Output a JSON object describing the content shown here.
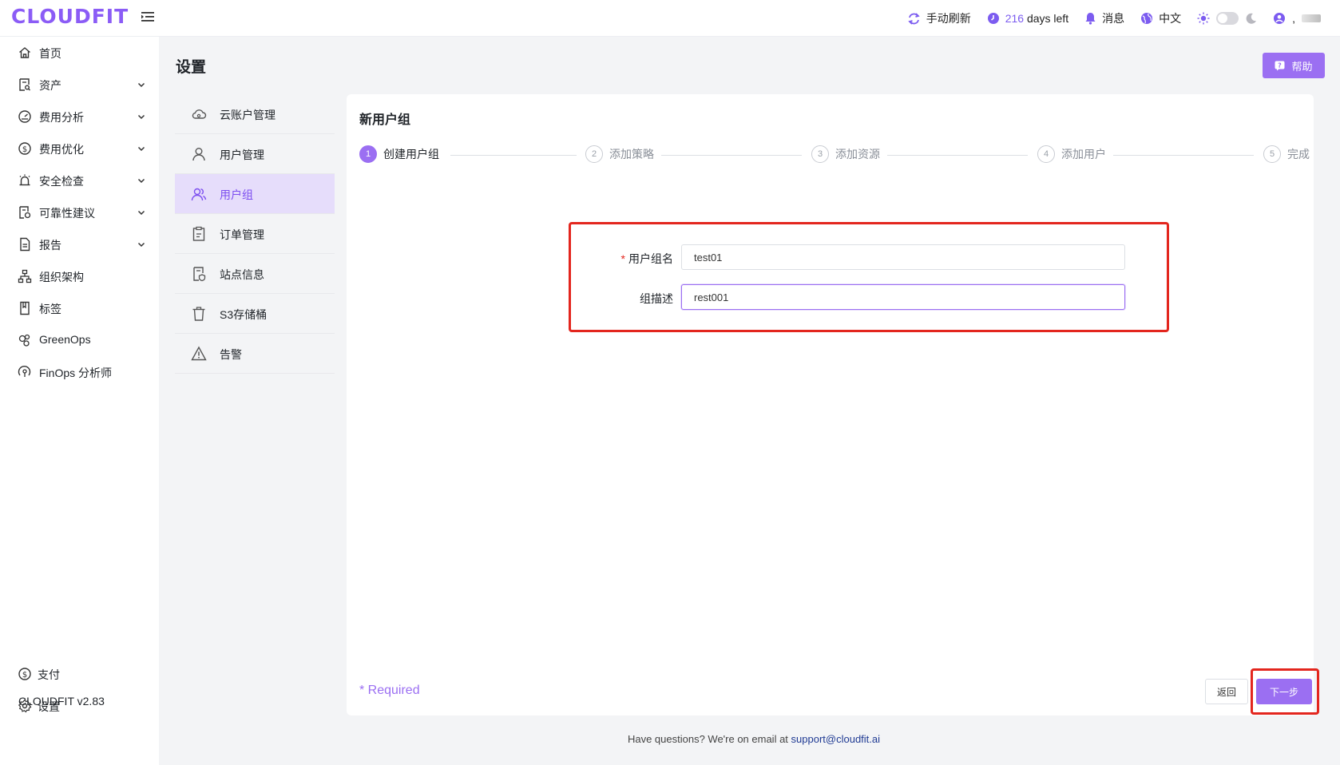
{
  "app": {
    "logo": "CLOUDFIT"
  },
  "topbar": {
    "refresh_label": "手动刷新",
    "days_value": "216",
    "days_suffix": "days left",
    "messages_label": "消息",
    "language_label": "中文",
    "user_suffix": ","
  },
  "sidebar": {
    "items": [
      {
        "label": "首页",
        "icon": "home-icon",
        "has_children": false
      },
      {
        "label": "资产",
        "icon": "asset-icon",
        "has_children": true
      },
      {
        "label": "费用分析",
        "icon": "cost-analysis-icon",
        "has_children": true
      },
      {
        "label": "费用优化",
        "icon": "dollar-icon",
        "has_children": true
      },
      {
        "label": "安全检查",
        "icon": "alarm-icon",
        "has_children": true
      },
      {
        "label": "可靠性建议",
        "icon": "reliability-icon",
        "has_children": true
      },
      {
        "label": "报告",
        "icon": "report-icon",
        "has_children": true
      },
      {
        "label": "组织架构",
        "icon": "org-icon",
        "has_children": false
      },
      {
        "label": "标签",
        "icon": "tag-icon",
        "has_children": false
      },
      {
        "label": "GreenOps",
        "icon": "greenops-icon",
        "has_children": false
      },
      {
        "label": "FinOps 分析师",
        "icon": "analyst-icon",
        "has_children": false
      }
    ],
    "bottom": {
      "pay_label": "支付",
      "settings_label": "设置",
      "version": "CLOUDFIT v2.83"
    }
  },
  "page": {
    "title": "设置",
    "help_label": "帮助"
  },
  "submenu": {
    "items": [
      {
        "label": "云账户管理",
        "icon": "cloud-icon",
        "active": false
      },
      {
        "label": "用户管理",
        "icon": "user-icon",
        "active": false
      },
      {
        "label": "用户组",
        "icon": "user-group-icon",
        "active": true
      },
      {
        "label": "订单管理",
        "icon": "order-icon",
        "active": false
      },
      {
        "label": "站点信息",
        "icon": "site-icon",
        "active": false
      },
      {
        "label": "S3存储桶",
        "icon": "bucket-icon",
        "active": false
      },
      {
        "label": "告警",
        "icon": "warning-icon",
        "active": false
      }
    ]
  },
  "wizard": {
    "title": "新用户组",
    "steps": [
      {
        "num": "1",
        "label": "创建用户组",
        "active": true
      },
      {
        "num": "2",
        "label": "添加策略",
        "active": false
      },
      {
        "num": "3",
        "label": "添加资源",
        "active": false
      },
      {
        "num": "4",
        "label": "添加用户",
        "active": false
      },
      {
        "num": "5",
        "label": "完成",
        "active": false
      }
    ],
    "form": {
      "name_label": "用户组名",
      "name_required_mark": "*",
      "name_value": "test01",
      "desc_label": "组描述",
      "desc_value": "rest001"
    },
    "required_note": "* Required",
    "back_label": "返回",
    "next_label": "下一步"
  },
  "footer": {
    "text": "Have questions? We're on email at",
    "email": "support@cloudfit.ai"
  },
  "colors": {
    "accent": "#9b6ff2",
    "highlight": "#e3261e",
    "active_bg": "#e6ddfb"
  }
}
